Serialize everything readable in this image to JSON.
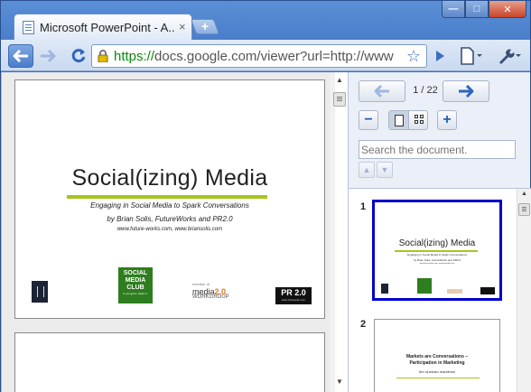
{
  "window": {
    "tab_title": "Microsoft PowerPoint - A...",
    "tab_close": "×",
    "new_tab": "+",
    "controls": {
      "minimize": "—",
      "maximize": "□",
      "close": "✕"
    }
  },
  "toolbar": {
    "url_scheme": "https://",
    "url_rest": "docs.google.com/viewer?url=http://www"
  },
  "slide1": {
    "title": "Social(izing) Media",
    "subtitle": "Engaging in Social Media to Spark Conversations",
    "byline": "by Brian Solis, FutureWorks and PR2.0",
    "websites": "www.future-works.com, www.briansolis.com",
    "logos": {
      "smc_line1": "SOCIAL",
      "smc_line2": "MEDIA",
      "smc_line3": "CLUB",
      "smc_tag": "If you get it, share it.",
      "media_rep": "member of",
      "media_name": "media",
      "media_num": "2.0",
      "media_work": "WORKGROUP",
      "pr_name": "PR 2.0",
      "pr_url": "www.briansolis.com"
    }
  },
  "panel": {
    "page_indicator": "1 / 22",
    "search_placeholder": "Search the document.",
    "thumb1_num": "1",
    "thumb2_num": "2",
    "thumb1": {
      "title": "Social(izing) Media",
      "line1": "Engaging in Social Media to Spark Conversations",
      "line2": "by Brian Solis, FutureWorks and PR2.0",
      "line3": "www.future-works.com, www.briansolis.com"
    },
    "thumb2": {
      "line1": "Markets are Conversations –",
      "line2": "Participation in Marketing",
      "line3": "the cluetrain manifesto"
    }
  },
  "colors": {
    "accent": "#3b6fc2",
    "rule_green": "#a6c61a",
    "selected_thumb": "#0000cc"
  }
}
